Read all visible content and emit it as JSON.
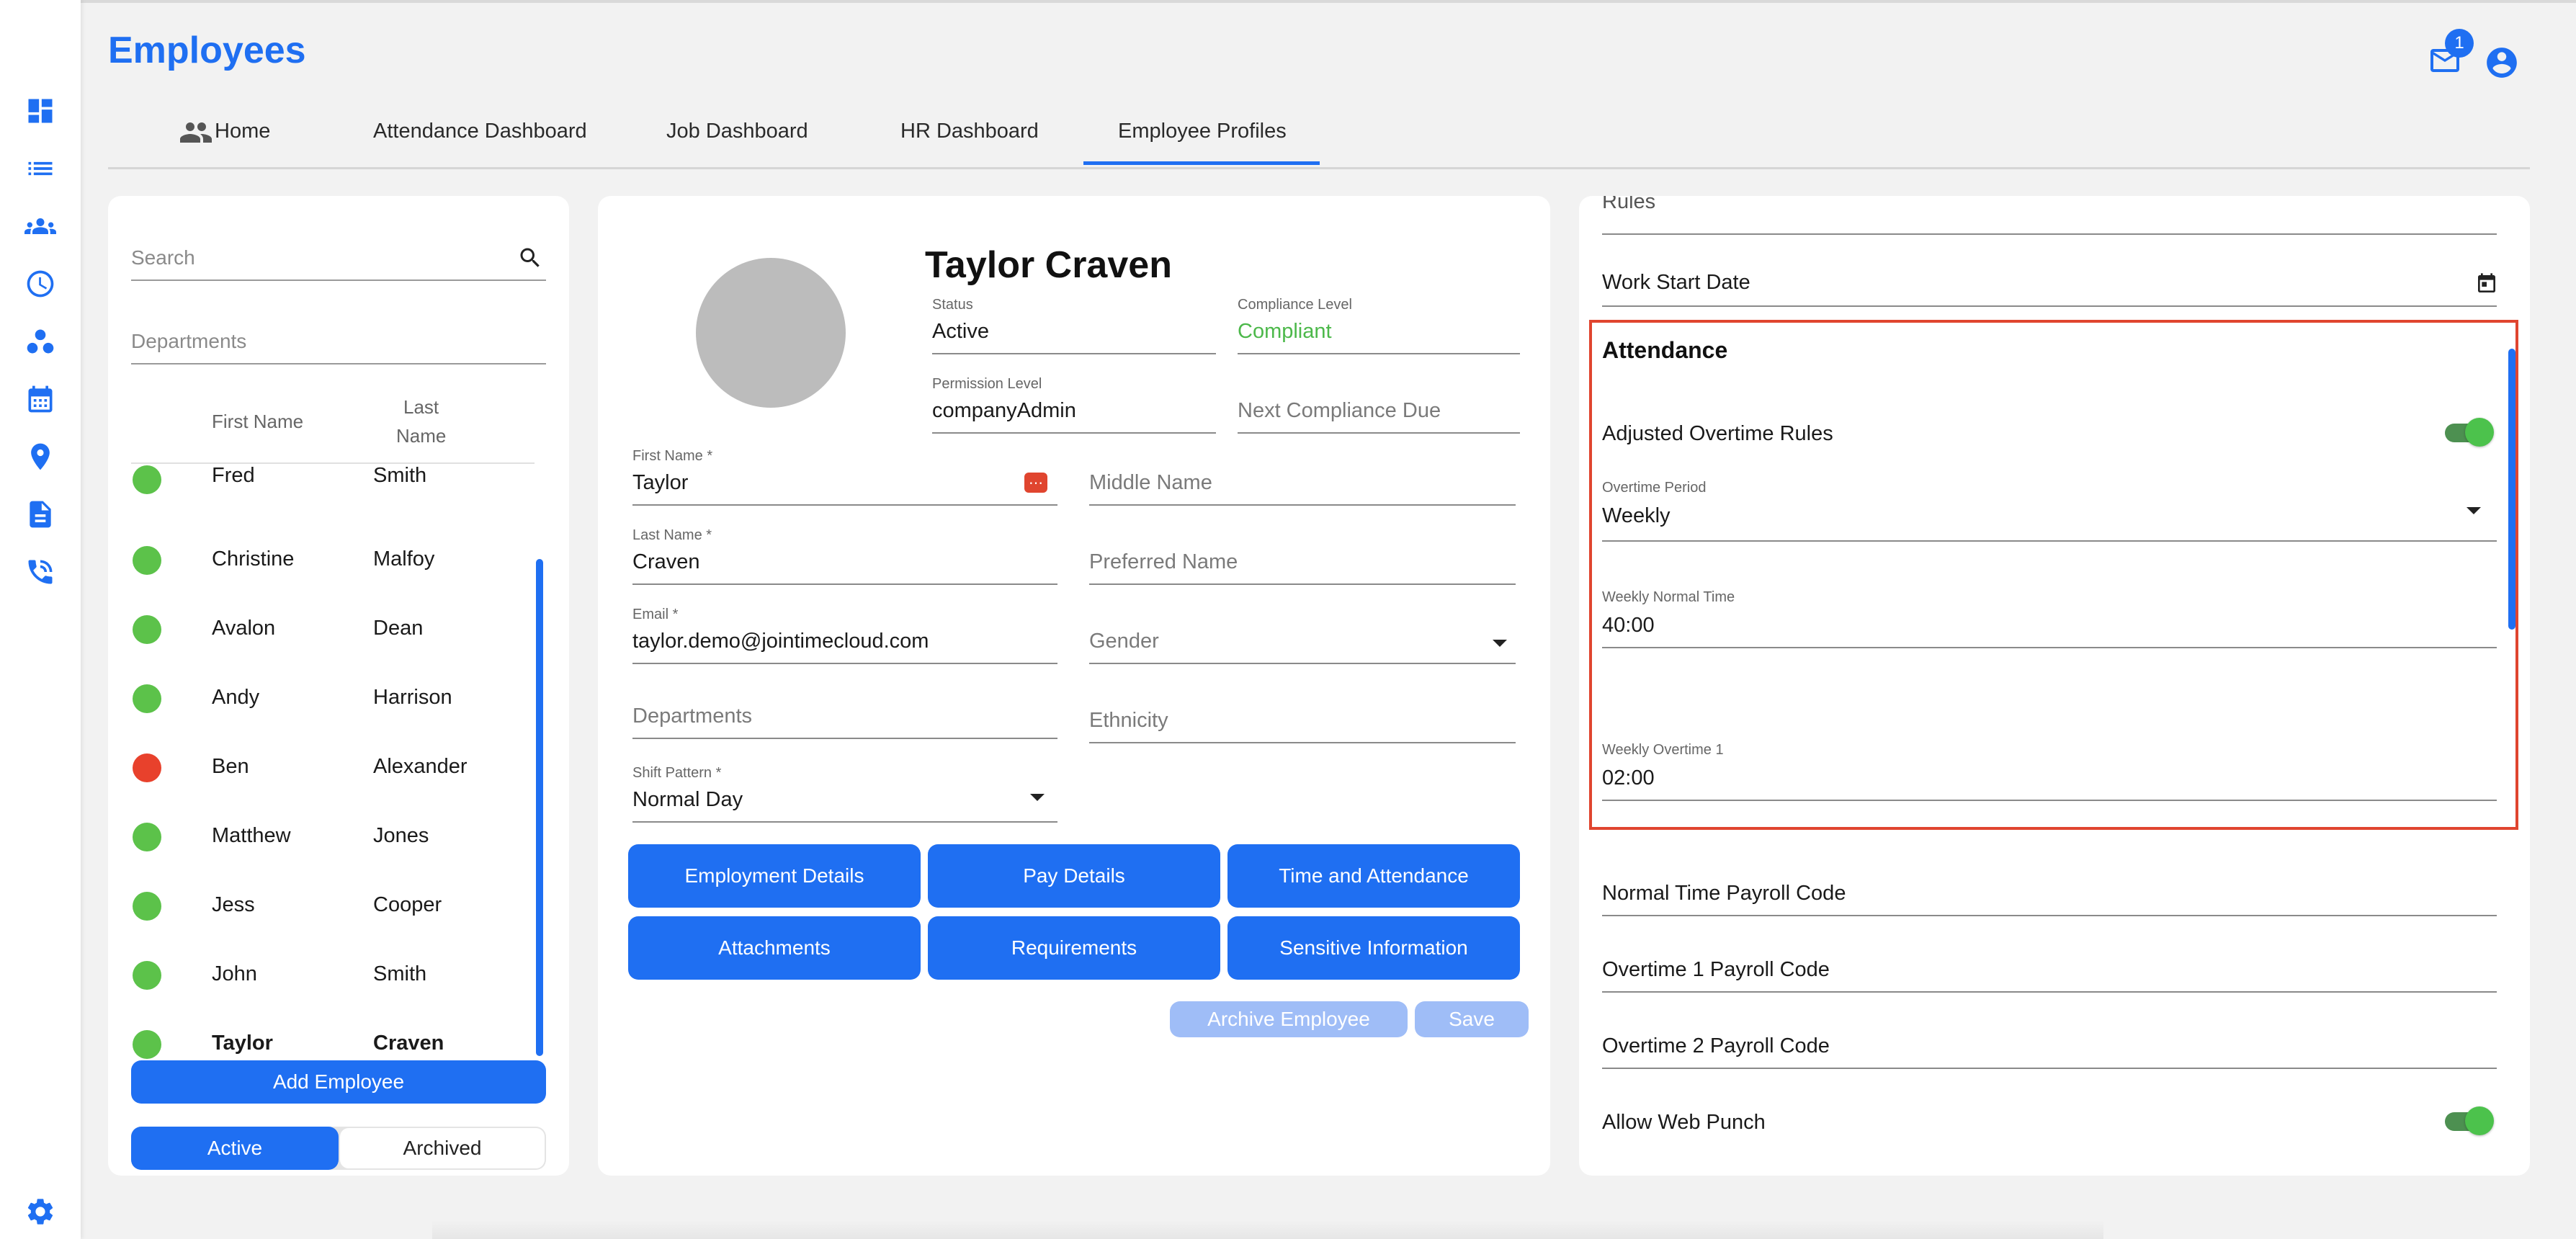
{
  "app": {
    "title": "Employees"
  },
  "header": {
    "mail_count": "1"
  },
  "tabs": [
    {
      "label": "Home"
    },
    {
      "label": "Attendance Dashboard"
    },
    {
      "label": "Job Dashboard"
    },
    {
      "label": "HR Dashboard"
    },
    {
      "label": "Employee Profiles"
    }
  ],
  "list_panel": {
    "search_placeholder": "Search",
    "departments_placeholder": "Departments",
    "col_first": "First Name",
    "col_last_1": "Last",
    "col_last_2": "Name",
    "employees": [
      {
        "first": "Fred",
        "last": "Smith",
        "status": "green"
      },
      {
        "first": "Christine",
        "last": "Malfoy",
        "status": "green"
      },
      {
        "first": "Avalon",
        "last": "Dean",
        "status": "green"
      },
      {
        "first": "Andy",
        "last": "Harrison",
        "status": "green"
      },
      {
        "first": "Ben",
        "last": "Alexander",
        "status": "red"
      },
      {
        "first": "Matthew",
        "last": "Jones",
        "status": "green"
      },
      {
        "first": "Jess",
        "last": "Cooper",
        "status": "green"
      },
      {
        "first": "John",
        "last": "Smith",
        "status": "green"
      },
      {
        "first": "Taylor",
        "last": "Craven",
        "status": "green"
      }
    ],
    "add_button": "Add Employee",
    "toggle_active": "Active",
    "toggle_archived": "Archived"
  },
  "profile": {
    "name": "Taylor Craven",
    "status_label": "Status",
    "status_value": "Active",
    "compliance_label": "Compliance Level",
    "compliance_value": "Compliant",
    "permission_label": "Permission Level",
    "permission_value": "companyAdmin",
    "next_compliance_placeholder": "Next Compliance Due",
    "first_name_label": "First Name *",
    "first_name_value": "Taylor",
    "middle_name_placeholder": "Middle Name",
    "last_name_label": "Last Name *",
    "last_name_value": "Craven",
    "preferred_name_placeholder": "Preferred Name",
    "email_label": "Email *",
    "email_value": "taylor.demo@jointimecloud.com",
    "gender_placeholder": "Gender",
    "departments_placeholder": "Departments",
    "ethnicity_placeholder": "Ethnicity",
    "shift_label": "Shift Pattern *",
    "shift_value": "Normal Day",
    "buttons": {
      "employment": "Employment Details",
      "pay": "Pay Details",
      "time": "Time and Attendance",
      "attachments": "Attachments",
      "requirements": "Requirements",
      "sensitive": "Sensitive Information"
    },
    "archive_button": "Archive Employee",
    "save_button": "Save"
  },
  "settings_panel": {
    "rules_partial": "Rules",
    "work_start_placeholder": "Work Start Date",
    "attendance_heading": "Attendance",
    "adjusted_overtime_label": "Adjusted Overtime Rules",
    "adjusted_overtime_on": true,
    "overtime_period_label": "Overtime Period",
    "overtime_period_value": "Weekly",
    "weekly_normal_label": "Weekly Normal Time",
    "weekly_normal_value": "40:00",
    "weekly_overtime1_label": "Weekly Overtime 1",
    "weekly_overtime1_value": "02:00",
    "normal_payroll_placeholder": "Normal Time Payroll Code",
    "ot1_payroll_placeholder": "Overtime 1 Payroll Code",
    "ot2_payroll_placeholder": "Overtime 2 Payroll Code",
    "allow_web_punch_label": "Allow Web Punch",
    "allow_web_punch_on": true
  },
  "colors": {
    "accent": "#1f6ff2",
    "status_green": "#5cc24a",
    "status_red": "#e8412c",
    "compliant": "#4cb84a",
    "highlight_box": "#e0452f"
  }
}
